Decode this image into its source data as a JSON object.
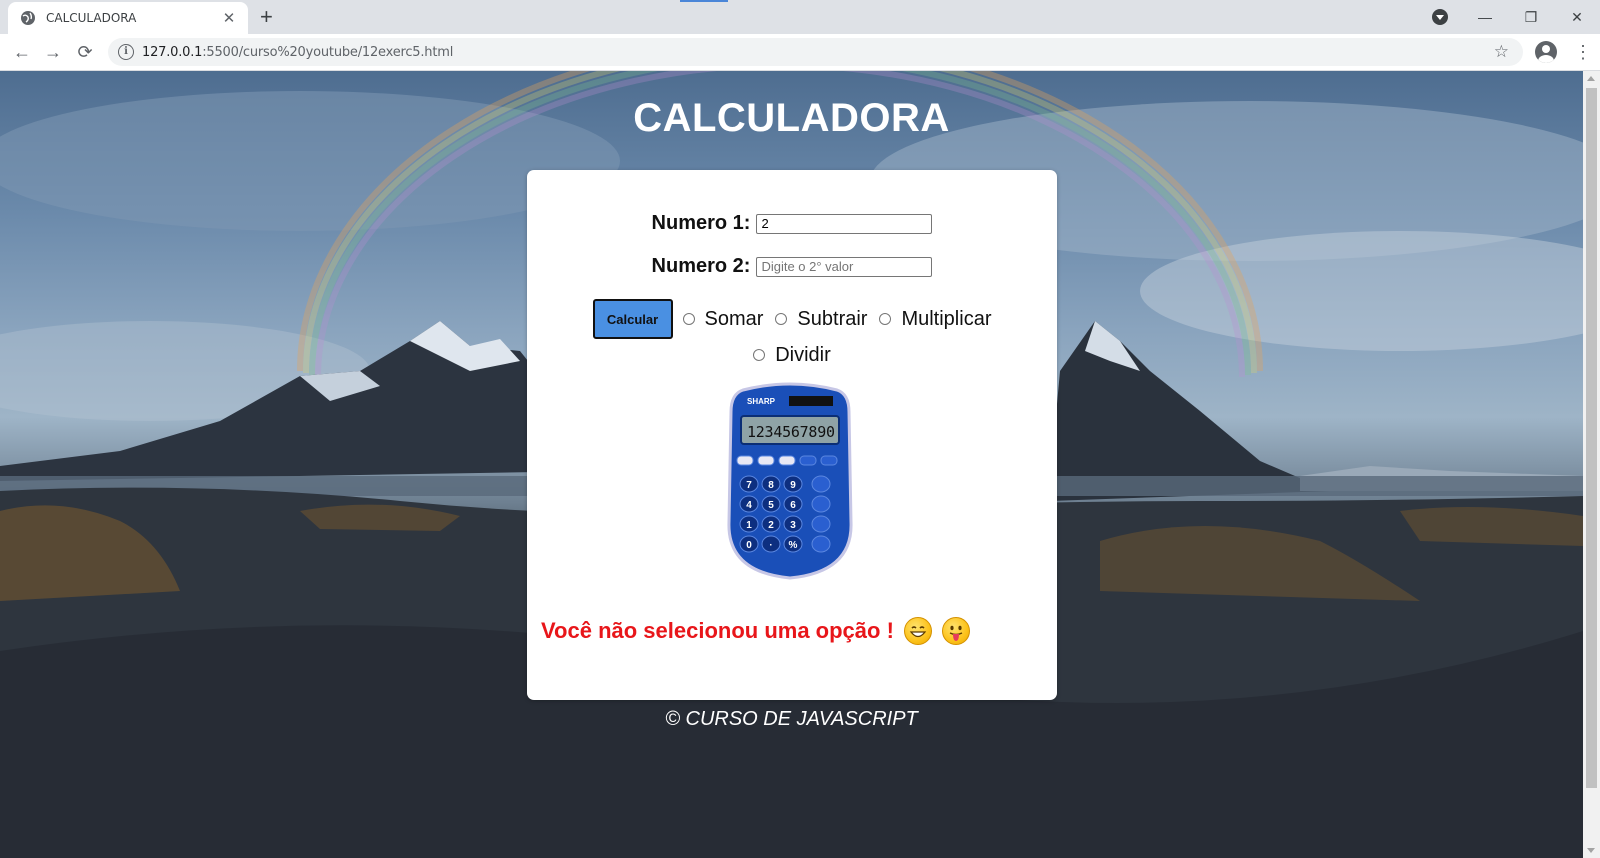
{
  "browser": {
    "tab_title": "CALCULADORA",
    "tab_close": "✕",
    "new_tab": "+",
    "url_host": "127.0.0.1",
    "url_rest": ":5500/curso%20youtube/12exerc5.html",
    "window_controls": [
      "—",
      "❐",
      "✕"
    ]
  },
  "page": {
    "title": "CALCULADORA",
    "form": {
      "numero1_label": "Numero 1:",
      "numero1_value": "2",
      "numero2_label": "Numero 2:",
      "numero2_placeholder": "Digite o 2° valor",
      "calcular_label": "Calcular",
      "options": [
        "Somar",
        "Subtrair",
        "Multiplicar",
        "Dividir"
      ]
    },
    "calculator_image": {
      "brand": "SHARP",
      "display": "1234567890",
      "keys": [
        [
          "7",
          "8",
          "9"
        ],
        [
          "4",
          "5",
          "6"
        ],
        [
          "1",
          "2",
          "3"
        ],
        [
          "0",
          "·",
          "%"
        ]
      ]
    },
    "message": "Você não selecionou uma opção !",
    "footer": "© CURSO DE JAVASCRIPT"
  },
  "colors": {
    "message": "#e8161a",
    "button": "#4a90e2",
    "calculator_body": "#1a4fb8"
  }
}
